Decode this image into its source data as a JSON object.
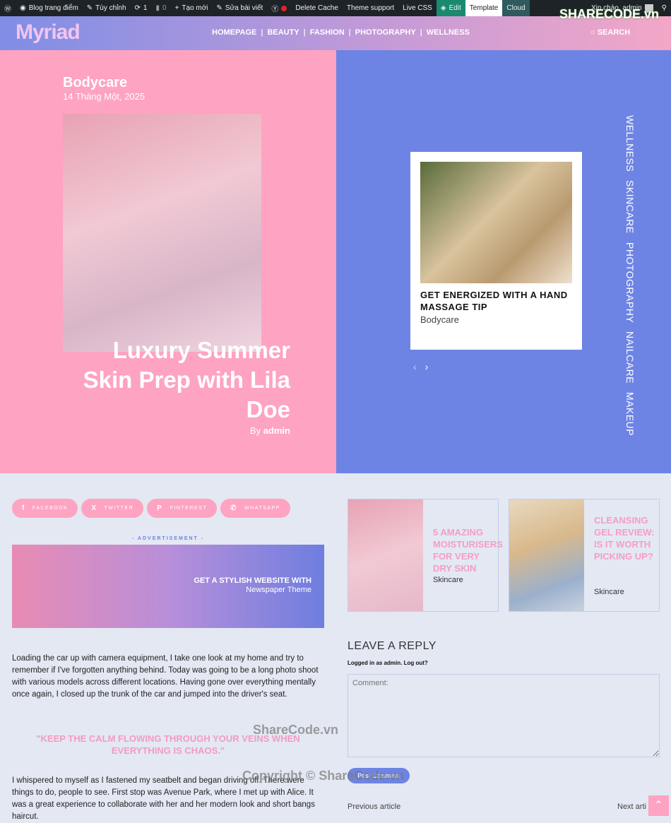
{
  "admin_bar": {
    "site": "Blog trang điểm",
    "customize": "Tùy chỉnh",
    "updates": "1",
    "comments": "0",
    "new": "Tạo mới",
    "edit_post": "Sửa bài viết",
    "delete_cache": "Delete Cache",
    "theme_support": "Theme support",
    "live_css": "Live CSS",
    "edit": "Edit",
    "template": "Template",
    "cloud": "Cloud",
    "greeting": "Xin chào, admin"
  },
  "header": {
    "logo": "Myriad",
    "nav": [
      "HOMEPAGE",
      "BEAUTY",
      "FASHION",
      "PHOTOGRAPHY",
      "WELLNESS"
    ],
    "search": "SEARCH"
  },
  "watermark": {
    "logo": "SHARECODE.vn",
    "mid": "ShareCode.vn",
    "copyright": "Copyright © ShareCode.vn"
  },
  "hero": {
    "category": "Bodycare",
    "date": "14 Tháng Một, 2025",
    "title": "Luxury Summer Skin Prep with Lila Doe",
    "by": "By",
    "author": "admin"
  },
  "slider": {
    "title": "GET ENERGIZED WITH A HAND MASSAGE TIP",
    "category": "Bodycare",
    "categories": [
      "WELLNESS",
      "SKINCARE",
      "PHOTOGRAPHY",
      "NAILCARE",
      "MAKEUP"
    ]
  },
  "share": [
    "FACEBOOK",
    "TWITTER",
    "PINTEREST",
    "WHATSAPP"
  ],
  "ad": {
    "label": "- ADVERTISEMENT -",
    "line1": "GET A STYLISH WEBSITE WITH",
    "line2": "Newspaper Theme"
  },
  "article": {
    "p1": "Loading the car up with camera equipment, I take one look at my home and try to remember if I've forgotten anything behind. Today was going to be a long photo shoot with various models across different locations. Having gone over everything mentally once again, I closed up the trunk of the car and jumped into the driver's seat.",
    "quote": "\"KEEP THE CALM FLOWING THROUGH YOUR VEINS WHEN EVERYTHING IS CHAOS.\"",
    "p2": "I whispered to myself as I fastened my seatbelt and began driving off. There were things to do, people to see. First stop was Avenue Park, where I met up with Alice. It was a great experience to collaborate with her and her modern look and short bangs haircut."
  },
  "related": [
    {
      "title": "5 AMAZING MOISTURISERS FOR VERY DRY SKIN",
      "category": "Skincare"
    },
    {
      "title": "CLEANSING GEL REVIEW: IS IT WORTH PICKING UP?",
      "category": "Skincare"
    }
  ],
  "reply": {
    "heading": "LEAVE A REPLY",
    "logged": "Logged in as admin. Log out?",
    "placeholder": "Comment:",
    "button": "Post Comment",
    "prev": "Previous article",
    "next": "Next arti"
  },
  "colors": {
    "pink": "#fea3c1",
    "blue": "#6e84e4",
    "bg": "#e3e8f2"
  }
}
